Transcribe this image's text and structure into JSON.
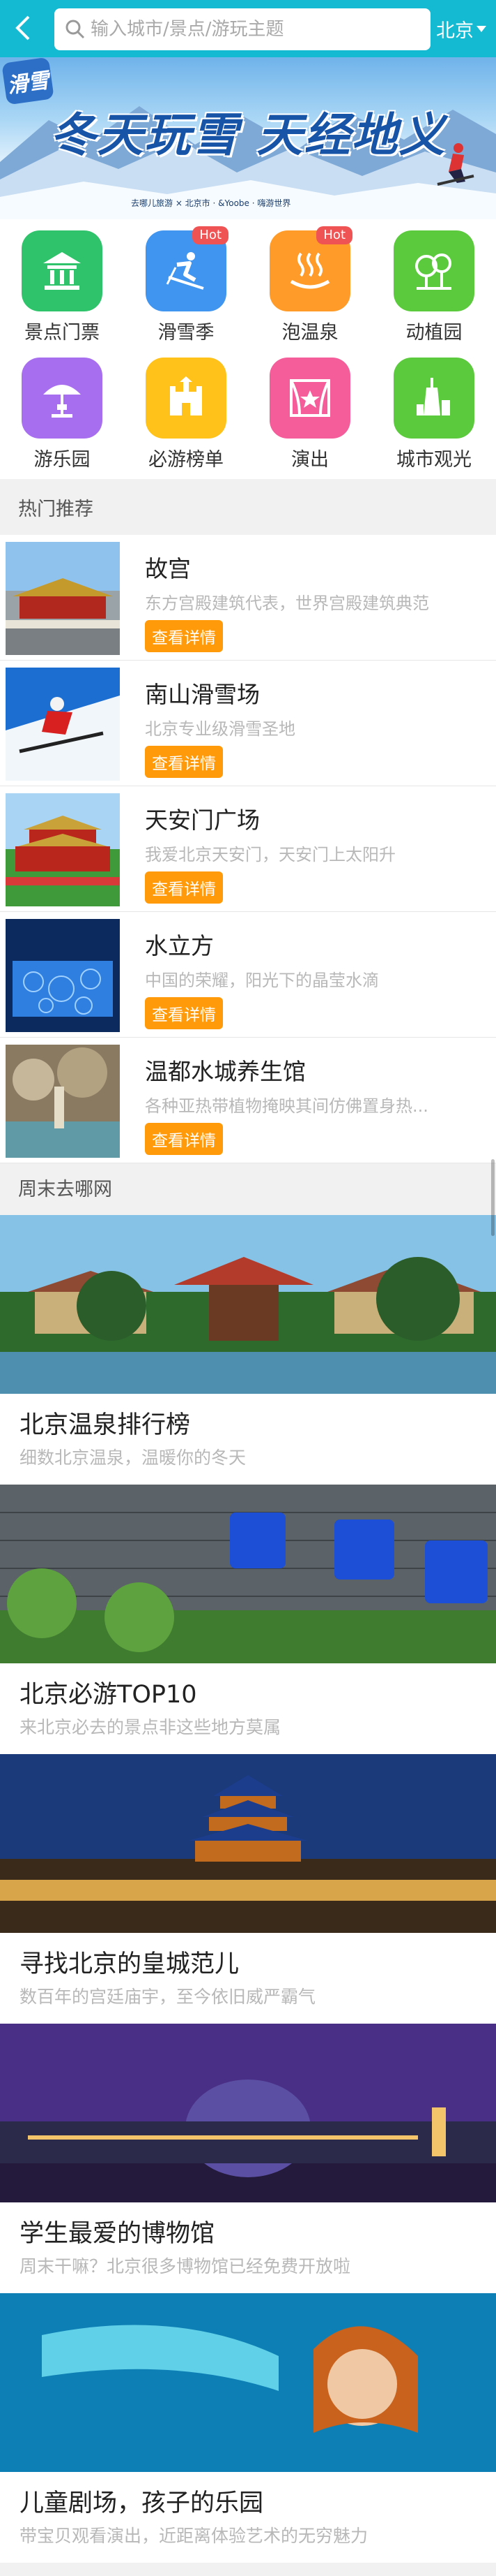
{
  "header": {
    "search_placeholder": "输入城市/景点/游玩主题",
    "city": "北京"
  },
  "banner": {
    "brand": "滑雪",
    "slogan": "冬天玩雪 天经地义",
    "sponsors": "去哪儿旅游 × 北京市 · &Yoobe · 嗨游世界"
  },
  "categories": [
    {
      "label": "景点门票",
      "icon": "temple-icon",
      "color": "#2fc46b",
      "hot": ""
    },
    {
      "label": "滑雪季",
      "icon": "skier-icon",
      "color": "#3f95ef",
      "hot": "Hot"
    },
    {
      "label": "泡温泉",
      "icon": "hot-spring-icon",
      "color": "#ff9c29",
      "hot": "Hot"
    },
    {
      "label": "动植园",
      "icon": "tree-icon",
      "color": "#5cca3d",
      "hot": ""
    },
    {
      "label": "游乐园",
      "icon": "parasol-icon",
      "color": "#a86ef0",
      "hot": ""
    },
    {
      "label": "必游榜单",
      "icon": "castle-icon",
      "color": "#ffc21b",
      "hot": ""
    },
    {
      "label": "演出",
      "icon": "stage-icon",
      "color": "#f55c9a",
      "hot": ""
    },
    {
      "label": "城市观光",
      "icon": "tower-icon",
      "color": "#5cca3d",
      "hot": ""
    }
  ],
  "recommend": {
    "title": "热门推荐",
    "button_label": "查看详情",
    "items": [
      {
        "name": "故宫",
        "desc": "东方宫殿建筑代表，世界宫殿建筑典范"
      },
      {
        "name": "南山滑雪场",
        "desc": "北京专业级滑雪圣地"
      },
      {
        "name": "天安门广场",
        "desc": "我爱北京天安门，天安门上太阳升"
      },
      {
        "name": "水立方",
        "desc": "中国的荣耀，阳光下的晶莹水滴"
      },
      {
        "name": "温都水城养生馆",
        "desc": "各种亚热带植物掩映其间仿佛置身热..."
      }
    ]
  },
  "weekend": {
    "title": "周末去哪网",
    "items": [
      {
        "title": "北京温泉排行榜",
        "subtitle": "细数北京温泉，温暖你的冬天"
      },
      {
        "title": "北京必游TOP10",
        "subtitle": "来北京必去的景点非这些地方莫属"
      },
      {
        "title": "寻找北京的皇城范儿",
        "subtitle": "数百年的宫廷庙宇，至今依旧威严霸气"
      },
      {
        "title": "学生最爱的博物馆",
        "subtitle": "周末干嘛？北京很多博物馆已经免费开放啦"
      },
      {
        "title": "儿童剧场，孩子的乐园",
        "subtitle": "带宝贝观看演出，近距离体验艺术的无穷魅力"
      }
    ]
  }
}
